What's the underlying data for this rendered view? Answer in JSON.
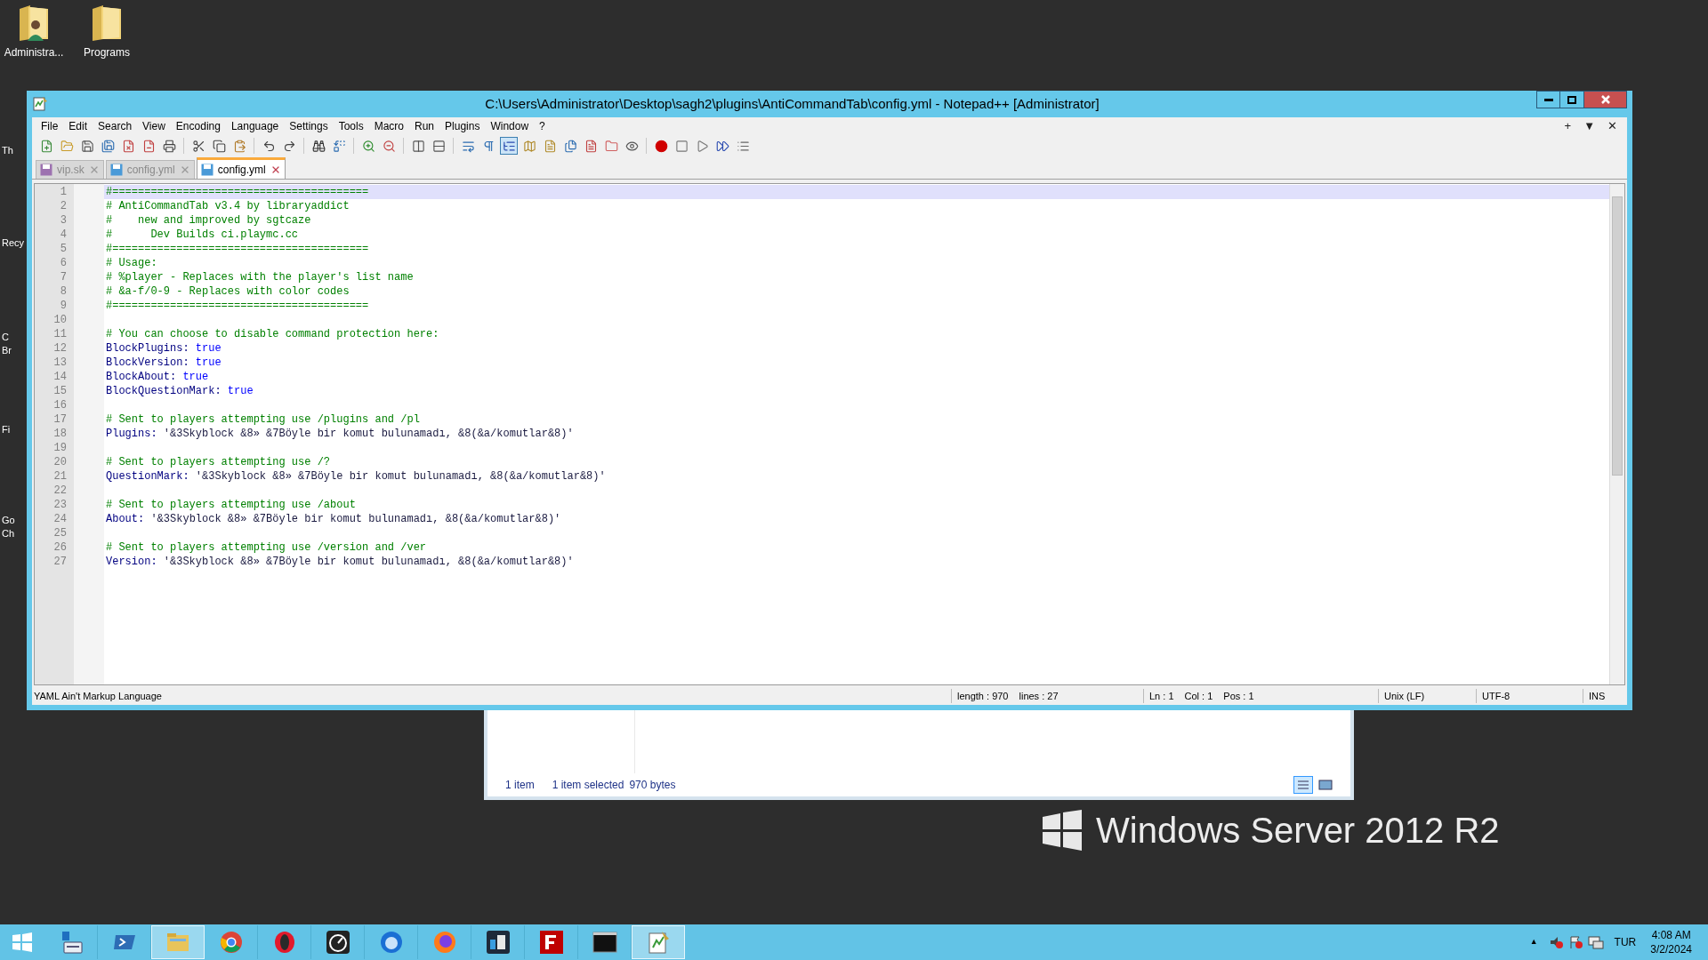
{
  "desktop": {
    "icons": [
      {
        "label": "Administra..."
      },
      {
        "label": "Programs"
      }
    ],
    "partial_labels": [
      {
        "lines": [
          "Th"
        ]
      },
      {
        "lines": [
          "Recy"
        ]
      },
      {
        "lines": [
          "C",
          "Br"
        ]
      },
      {
        "lines": [
          "Fi"
        ]
      },
      {
        "lines": [
          "Go",
          "Ch"
        ]
      }
    ],
    "watermark": "Windows Server 2012 R2"
  },
  "window": {
    "title": "C:\\Users\\Administrator\\Desktop\\sagh2\\plugins\\AntiCommandTab\\config.yml - Notepad++ [Administrator]"
  },
  "menu": [
    "File",
    "Edit",
    "Search",
    "View",
    "Encoding",
    "Language",
    "Settings",
    "Tools",
    "Macro",
    "Run",
    "Plugins",
    "Window",
    "?"
  ],
  "menu_bar_controls": [
    "+",
    "▼",
    "✕"
  ],
  "toolbar": {
    "indent_guide_on": true
  },
  "tabs": [
    {
      "label": "vip.sk",
      "selected": false
    },
    {
      "label": "config.yml",
      "selected": false
    },
    {
      "label": "config.yml",
      "selected": true
    }
  ],
  "editor": {
    "lines": [
      {
        "number": "1",
        "kind": "comment",
        "text": "#========================================",
        "current": true
      },
      {
        "number": "2",
        "kind": "comment",
        "text": "# AntiCommandTab v3.4 by libraryaddict",
        "current": false
      },
      {
        "number": "3",
        "kind": "comment",
        "text": "#    new and improved by sgtcaze",
        "current": false
      },
      {
        "number": "4",
        "kind": "comment",
        "text": "#      Dev Builds ci.playmc.cc",
        "current": false
      },
      {
        "number": "5",
        "kind": "comment",
        "text": "#========================================",
        "current": false
      },
      {
        "number": "6",
        "kind": "comment",
        "text": "# Usage:",
        "current": false
      },
      {
        "number": "7",
        "kind": "comment",
        "text": "# %player - Replaces with the player's list name",
        "current": false
      },
      {
        "number": "8",
        "kind": "comment",
        "text": "# &a-f/0-9 - Replaces with color codes",
        "current": false
      },
      {
        "number": "9",
        "kind": "comment",
        "text": "#========================================",
        "current": false
      },
      {
        "number": "10",
        "kind": "blank",
        "current": false
      },
      {
        "number": "11",
        "kind": "comment",
        "text": "# You can choose to disable command protection here:",
        "current": false
      },
      {
        "number": "12",
        "kind": "pair",
        "key": "BlockPlugins:",
        "value": "true",
        "current": false
      },
      {
        "number": "13",
        "kind": "pair",
        "key": "BlockVersion:",
        "value": "true",
        "current": false
      },
      {
        "number": "14",
        "kind": "pair",
        "key": "BlockAbout:",
        "value": "true",
        "current": false
      },
      {
        "number": "15",
        "kind": "pair",
        "key": "BlockQuestionMark:",
        "value": "true",
        "current": false
      },
      {
        "number": "16",
        "kind": "blank",
        "current": false
      },
      {
        "number": "17",
        "kind": "comment",
        "text": "# Sent to players attempting use /plugins and /pl",
        "current": false
      },
      {
        "number": "18",
        "kind": "message",
        "key": "Plugins:",
        "value": "'&3Skyblock &8» &7Böyle bir komut bulunamadı, &8(&a/komutlar&8)'",
        "current": false
      },
      {
        "number": "19",
        "kind": "blank",
        "current": false
      },
      {
        "number": "20",
        "kind": "comment",
        "text": "# Sent to players attempting use /?",
        "current": false
      },
      {
        "number": "21",
        "kind": "message",
        "key": "QuestionMark:",
        "value": "'&3Skyblock &8» &7Böyle bir komut bulunamadı, &8(&a/komutlar&8)'",
        "current": false
      },
      {
        "number": "22",
        "kind": "blank",
        "current": false
      },
      {
        "number": "23",
        "kind": "comment",
        "text": "# Sent to players attempting use /about",
        "current": false
      },
      {
        "number": "24",
        "kind": "message",
        "key": "About:",
        "value": "'&3Skyblock &8» &7Böyle bir komut bulunamadı, &8(&a/komutlar&8)'",
        "current": false
      },
      {
        "number": "25",
        "kind": "blank",
        "current": false
      },
      {
        "number": "26",
        "kind": "comment",
        "text": "# Sent to players attempting use /version and /ver",
        "current": false
      },
      {
        "number": "27",
        "kind": "message",
        "key": "Version:",
        "value": "'&3Skyblock &8» &7Böyle bir komut bulunamadı, &8(&a/komutlar&8)'",
        "current": false
      }
    ]
  },
  "status_bar": {
    "language": "YAML Ain't Markup Language",
    "length": "length : 970",
    "lines": "lines : 27",
    "ln": "Ln : 1",
    "col": "Col : 1",
    "pos": "Pos : 1",
    "eol": "Unix (LF)",
    "encoding": "UTF-8",
    "mode": "INS"
  },
  "explorer": {
    "item_count": "1 item",
    "selection": "1 item selected",
    "size": "970 bytes"
  },
  "taskbar": {
    "apps": [
      {
        "active": false
      },
      {
        "active": false
      },
      {
        "active": true
      },
      {
        "active": false
      },
      {
        "active": false
      },
      {
        "active": false
      },
      {
        "active": false
      },
      {
        "active": false
      },
      {
        "active": false
      },
      {
        "active": false
      },
      {
        "active": false
      },
      {
        "active": true
      }
    ],
    "tray_caret": "▲",
    "language": "TUR",
    "time": "4:08 AM",
    "date": "3/2/2024"
  }
}
